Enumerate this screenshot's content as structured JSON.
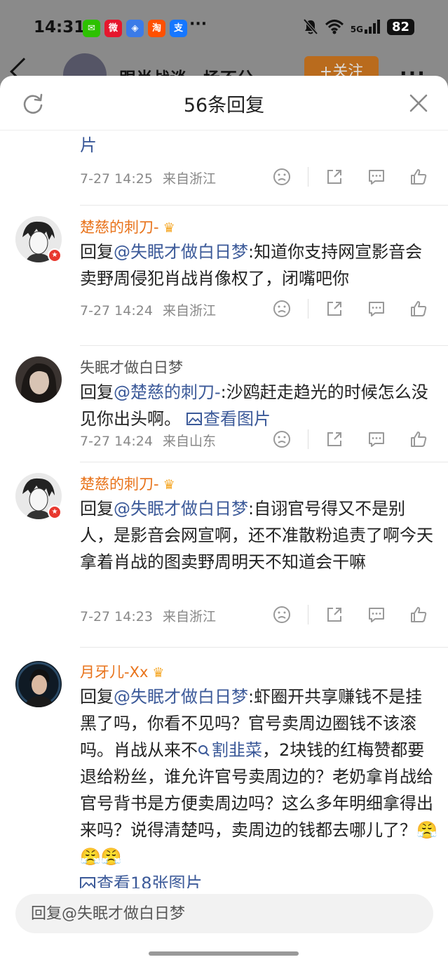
{
  "status_bar": {
    "time": "14:31",
    "notification_icons": [
      {
        "name": "wechat-icon",
        "glyph": "✉",
        "color": "#2dc100"
      },
      {
        "name": "weibo-icon",
        "glyph": "微",
        "color": "#e6162d"
      },
      {
        "name": "app-icon",
        "glyph": "◈",
        "color": "#3b7be8"
      },
      {
        "name": "taobao-icon",
        "glyph": "淘",
        "color": "#ff5000"
      },
      {
        "name": "alipay-icon",
        "glyph": "支",
        "color": "#1677ff"
      }
    ],
    "more": "···",
    "network": "5G",
    "battery": "82"
  },
  "background": {
    "title": "跟肖战谈一场不分",
    "follow_label": "+关注",
    "more": "···"
  },
  "sheet": {
    "title": "56条回复"
  },
  "comments": [
    {
      "partial": true,
      "text_tail": "片",
      "time": "7-27 14:25",
      "location": "来自浙江"
    },
    {
      "username": "楚慈的刺刀-",
      "crown": true,
      "name_color": "orange",
      "verified": true,
      "reply_prefix": "回复",
      "mention": "@失眠才做白日梦",
      "text": ":知道你支持网宣影音会卖野周侵犯肖战肖像权了，闭嘴吧你",
      "time": "7-27 14:24",
      "location": "来自浙江"
    },
    {
      "username": "失眠才做白日梦",
      "crown": false,
      "name_color": "gray",
      "verified": false,
      "reply_prefix": "回复",
      "mention": "@楚慈的刺刀-",
      "text": ":沙鸥赶走趋光的时候怎么没见你出头啊。",
      "image_link": "查看图片",
      "time": "7-27 14:24",
      "location": "来自山东"
    },
    {
      "username": "楚慈的刺刀-",
      "crown": true,
      "name_color": "orange",
      "verified": true,
      "reply_prefix": "回复",
      "mention": "@失眠才做白日梦",
      "text": ":自诩官号得又不是别人，是影音会网宣啊，还不准散粉追责了啊今天拿着肖战的图卖野周明天不知道会干嘛",
      "time": "7-27 14:23",
      "location": "来自浙江"
    },
    {
      "username": "月牙儿-Xx",
      "crown": true,
      "name_color": "orange",
      "verified": false,
      "reply_prefix": "回复",
      "mention": "@失眠才做白日梦",
      "text_before_search": ":虾圈开共享赚钱不是挂黑了吗，你看不见吗？官号卖周边圈钱不该滚吗。肖战从来不",
      "search_link": "割韭菜",
      "text_after_search": "，2块钱的红梅赞都要退给粉丝，谁允许官号卖周边的？老奶拿肖战给官号背书是方便卖周边吗？这么多年明细拿得出来吗？说得清楚吗，卖周边的钱都去哪儿了？",
      "emojis": "😤😤😤",
      "image_link": "查看18张图片"
    }
  ],
  "input": {
    "placeholder": "回复@失眠才做白日梦"
  }
}
